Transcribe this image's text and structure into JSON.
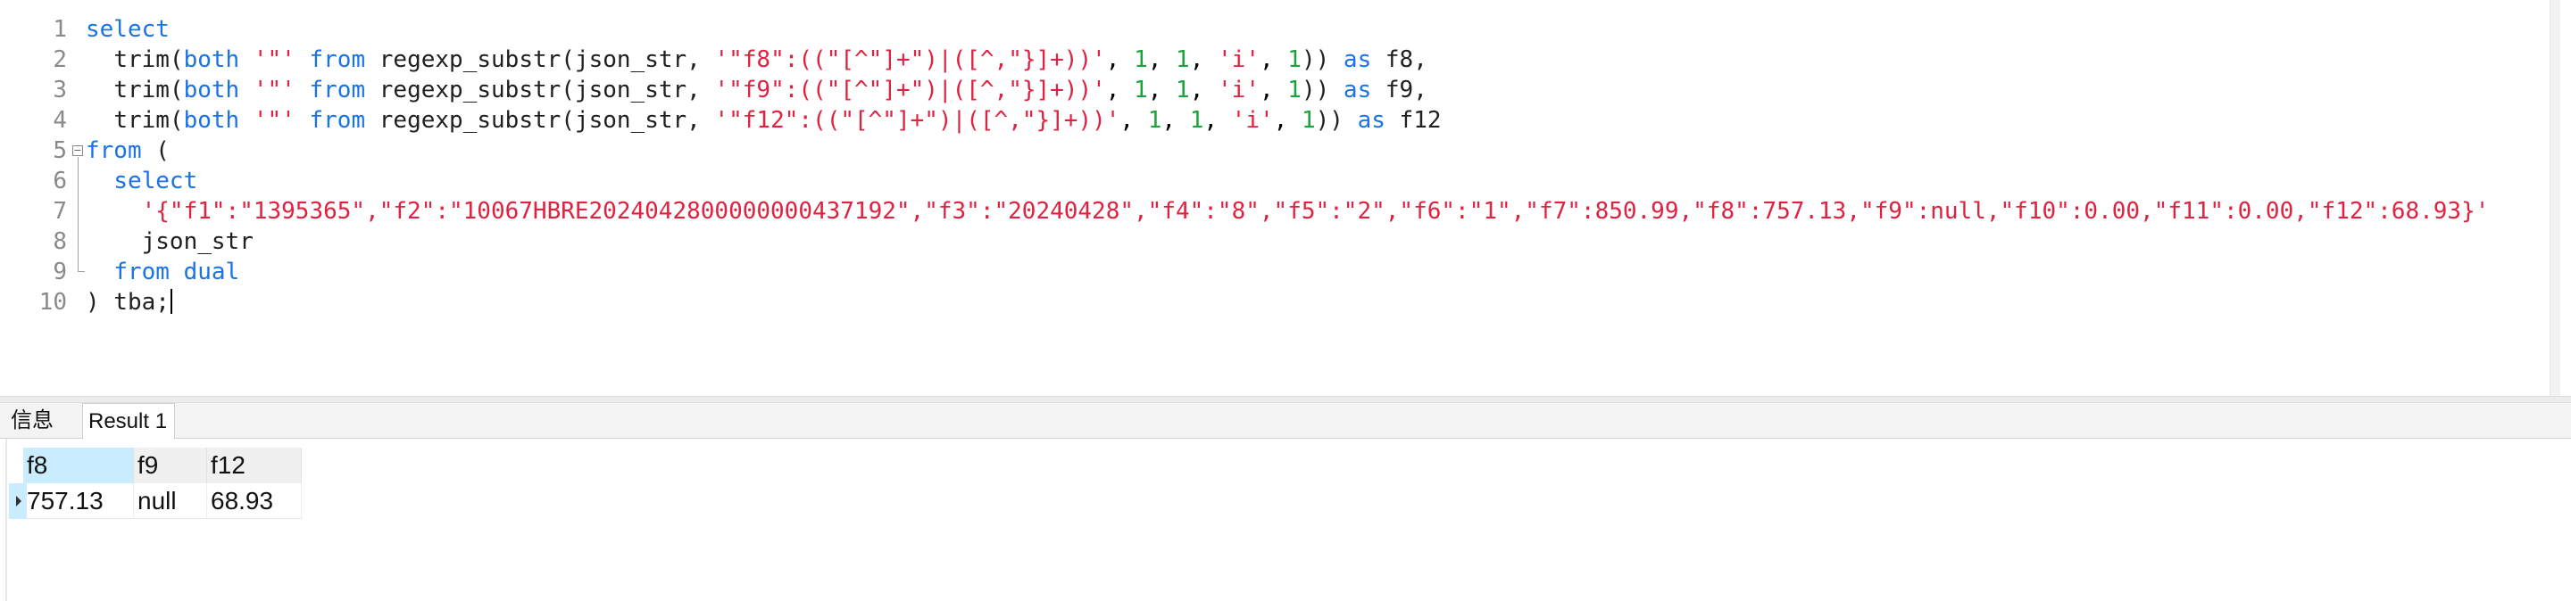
{
  "editor": {
    "line_numbers": [
      "1",
      "2",
      "3",
      "4",
      "5",
      "6",
      "7",
      "8",
      "9",
      "10"
    ],
    "fold_marker": "⊟",
    "tokens": {
      "select": "select",
      "trim": "trim(",
      "both": "both",
      "quote_lit": "'\"'",
      "from": "from",
      "regexp": "regexp_substr(json_str, ",
      "pat_f8": "'\"f8\":((\"[^\"]+\")|([^,\"}]+))'",
      "pat_f9": "'\"f9\":((\"[^\"]+\")|([^,\"}]+))'",
      "pat_f12": "'\"f12\":((\"[^\"]+\")|([^,\"}]+))'",
      "one": "1",
      "i_lit": "'i'",
      "close": "))",
      "as": "as",
      "f8": "f8,",
      "f9": "f9,",
      "f12": "f12",
      "from_paren": "(",
      "json_literal": "'{\"f1\":\"1395365\",\"f2\":\"10067HBRE2024042800000000437192\",\"f3\":\"20240428\",\"f4\":\"8\",\"f5\":\"2\",\"f6\":\"1\",\"f7\":850.99,\"f8\":757.13,\"f9\":null,\"f10\":0.00,\"f11\":0.00,\"f12\":68.93}'",
      "json_str": "json_str",
      "dual": "dual",
      "tba": ") tba;"
    }
  },
  "tabs": {
    "info": "信息",
    "result": "Result 1"
  },
  "result": {
    "columns": [
      "f8",
      "f9",
      "f12"
    ],
    "rows": [
      [
        "757.13",
        "null",
        "68.93"
      ]
    ]
  },
  "colors": {
    "keyword": "#1a73e8",
    "string": "#e0213f",
    "number": "#1ea33c",
    "selection": "#c9ecff"
  }
}
